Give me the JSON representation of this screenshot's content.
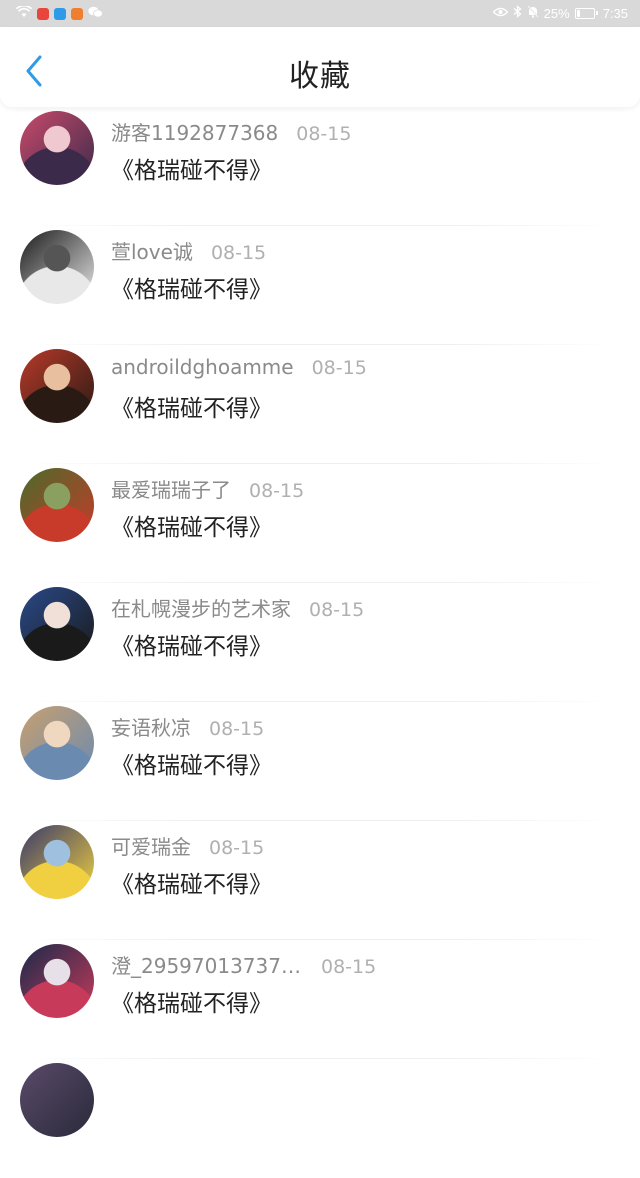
{
  "status_bar": {
    "battery_text": "25%",
    "time": "7:35",
    "battery_level": 0.25,
    "app_icon_colors": [
      "#e8453c",
      "#2f9be8",
      "#f07e2f"
    ]
  },
  "header": {
    "title": "收藏",
    "back_icon": "chevron-left-icon",
    "accent": "#2f9be8"
  },
  "favorites": [
    {
      "user": "游客1192877368",
      "date": "08-15",
      "title": "《格瑞碰不得》",
      "avatar_colors": [
        "#c94a6b",
        "#3b2a4a",
        "#f0c8d0"
      ]
    },
    {
      "user": "萱love诚",
      "date": "08-15",
      "title": "《格瑞碰不得》",
      "avatar_colors": [
        "#1a1a1a",
        "#e8e8e8",
        "#555555"
      ]
    },
    {
      "user": "androildghoamme",
      "date": "08-15",
      "title": "《格瑞碰不得》",
      "avatar_colors": [
        "#b83a2a",
        "#2a1a14",
        "#e8c0a0"
      ]
    },
    {
      "user": "最爱瑞瑞子了",
      "date": "08-15",
      "title": "《格瑞碰不得》",
      "avatar_colors": [
        "#4a6b2a",
        "#c83a2a",
        "#8aa060"
      ]
    },
    {
      "user": "在札幌漫步的艺术家",
      "date": "08-15",
      "title": "《格瑞碰不得》",
      "avatar_colors": [
        "#2a4a8a",
        "#1a1a1a",
        "#f0e0d8"
      ]
    },
    {
      "user": "妄语秋凉",
      "date": "08-15",
      "title": "《格瑞碰不得》",
      "avatar_colors": [
        "#c8a070",
        "#6a8ab0",
        "#f0d8c0"
      ]
    },
    {
      "user": "可爱瑞金",
      "date": "08-15",
      "title": "《格瑞碰不得》",
      "avatar_colors": [
        "#3a3a6a",
        "#f0d040",
        "#a0c0e0"
      ]
    },
    {
      "user": "澄_295970137371...",
      "date": "08-15",
      "title": "《格瑞碰不得》",
      "avatar_colors": [
        "#1a2a4a",
        "#c83a5a",
        "#e8e0e8"
      ]
    }
  ]
}
